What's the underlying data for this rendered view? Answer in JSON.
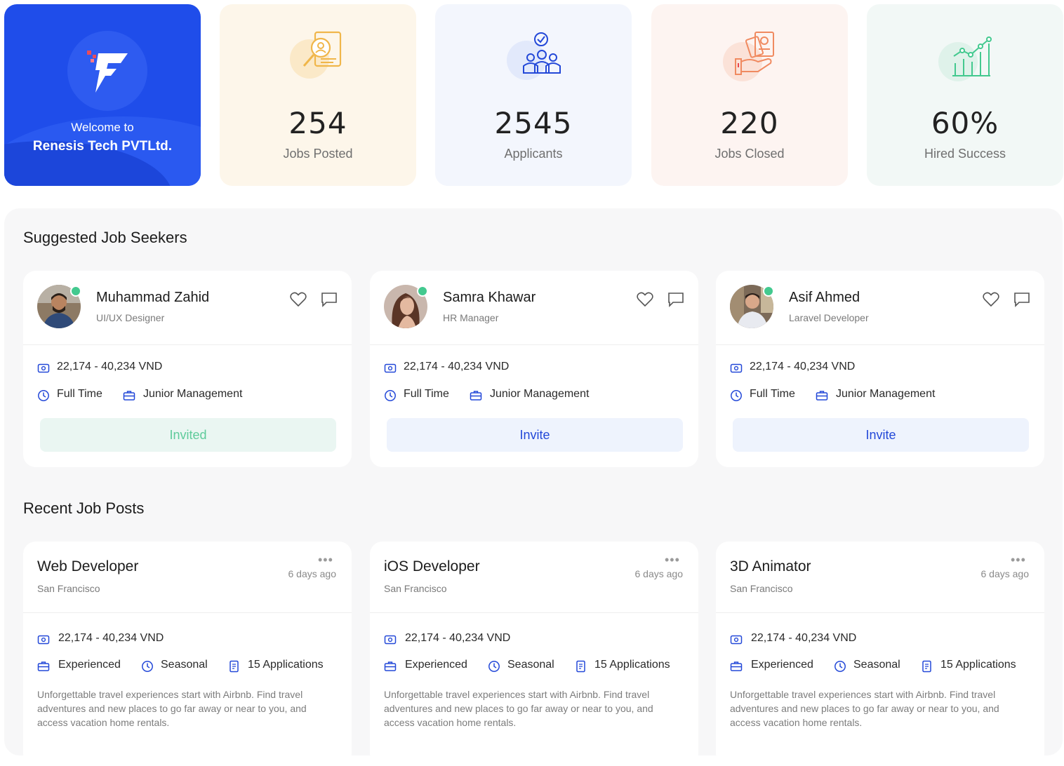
{
  "welcome": {
    "line1": "Welcome to",
    "line2": "Renesis Tech PVTLtd.",
    "icon": "company-logo-icon"
  },
  "stats": [
    {
      "value": "254",
      "label": "Jobs Posted",
      "icon": "resume-search-icon",
      "bg": "#fdf6ea",
      "accent": "#f0b64a"
    },
    {
      "value": "2545",
      "label": "Applicants",
      "icon": "team-check-icon",
      "bg": "#f3f6fd",
      "accent": "#2348d8"
    },
    {
      "value": "220",
      "label": "Jobs Closed",
      "icon": "hand-document-icon",
      "bg": "#fdf4f1",
      "accent": "#f08a60"
    },
    {
      "value": "60%",
      "label": "Hired Success",
      "icon": "growth-chart-icon",
      "bg": "#f2f8f6",
      "accent": "#43c98f"
    }
  ],
  "suggested": {
    "title": "Suggested Job Seekers",
    "cards": [
      {
        "name": "Muhammad Zahid",
        "role": "UI/UX Designer",
        "salary": "22,174 - 40,234 VND",
        "type": "Full Time",
        "level": "Junior Management",
        "action": "Invited"
      },
      {
        "name": "Samra Khawar",
        "role": "HR Manager",
        "salary": "22,174 - 40,234 VND",
        "type": "Full Time",
        "level": "Junior Management",
        "action": "Invite"
      },
      {
        "name": "Asif Ahmed",
        "role": "Laravel Developer",
        "salary": "22,174 - 40,234 VND",
        "type": "Full Time",
        "level": "Junior Management",
        "action": "Invite"
      }
    ]
  },
  "recent": {
    "title": "Recent Job Posts",
    "posts": [
      {
        "title": "Web Developer",
        "location": "San Francisco",
        "ago": "6 days ago",
        "salary": "22,174 - 40,234 VND",
        "experience": "Experienced",
        "schedule": "Seasonal",
        "applications": "15 Applications",
        "description": "Unforgettable travel experiences start with Airbnb. Find travel adventures and new places to go far away or near to you, and access vacation home rentals."
      },
      {
        "title": "iOS Developer",
        "location": "San Francisco",
        "ago": "6 days ago",
        "salary": "22,174 - 40,234 VND",
        "experience": "Experienced",
        "schedule": "Seasonal",
        "applications": "15 Applications",
        "description": "Unforgettable travel experiences start with Airbnb. Find travel adventures and new places to go far away or near to you, and access vacation home rentals."
      },
      {
        "title": "3D Animator",
        "location": "San Francisco",
        "ago": "6 days ago",
        "salary": "22,174 - 40,234 VND",
        "experience": "Experienced",
        "schedule": "Seasonal",
        "applications": "15 Applications",
        "description": "Unforgettable travel experiences start with Airbnb. Find travel adventures and new places to go far away or near to you, and access vacation home rentals."
      }
    ]
  },
  "colors": {
    "primary": "#1f4dea",
    "success": "#43c98f",
    "invite_bg": "#eef3fd",
    "invited_bg": "#eaf6f2"
  }
}
